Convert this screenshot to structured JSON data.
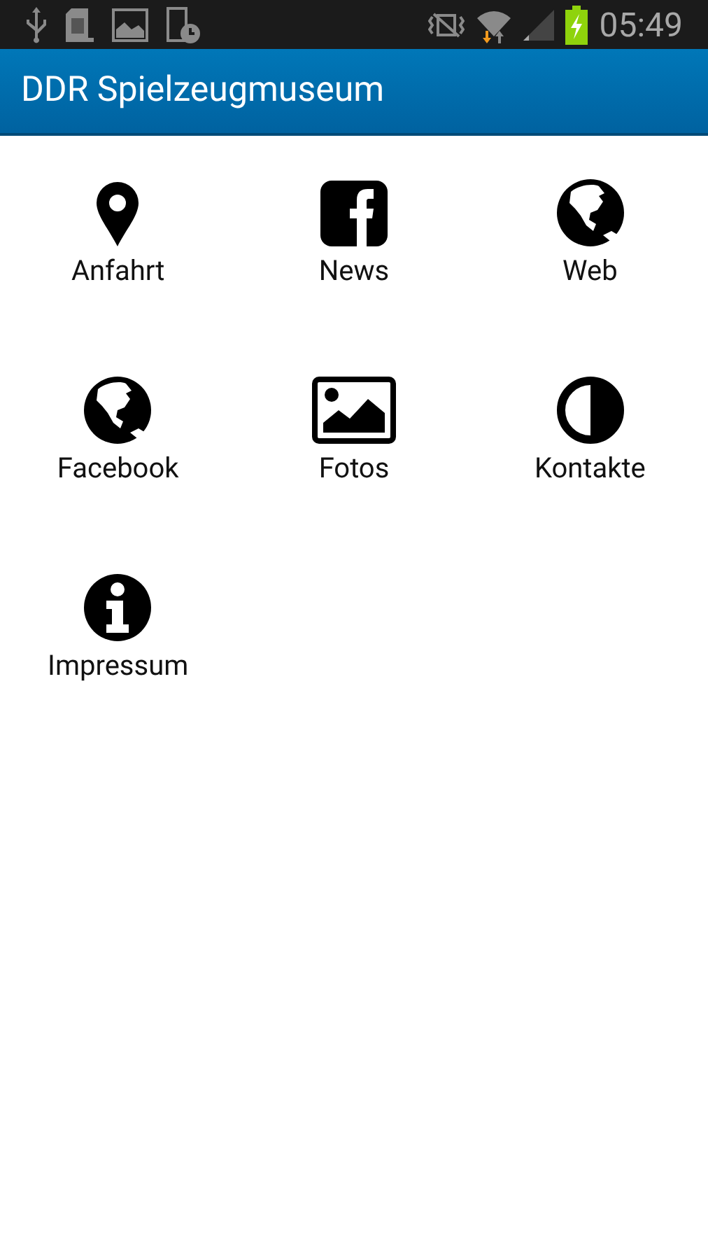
{
  "status_bar": {
    "time": "05:49"
  },
  "app_bar": {
    "title": "DDR Spielzeugmuseum"
  },
  "tiles": [
    {
      "label": "Anfahrt",
      "kind": "pin"
    },
    {
      "label": "News",
      "kind": "facebook"
    },
    {
      "label": "Web",
      "kind": "globe"
    },
    {
      "label": "Facebook",
      "kind": "globe"
    },
    {
      "label": "Fotos",
      "kind": "image"
    },
    {
      "label": "Kontakte",
      "kind": "contrast"
    },
    {
      "label": "Impressum",
      "kind": "info"
    }
  ]
}
